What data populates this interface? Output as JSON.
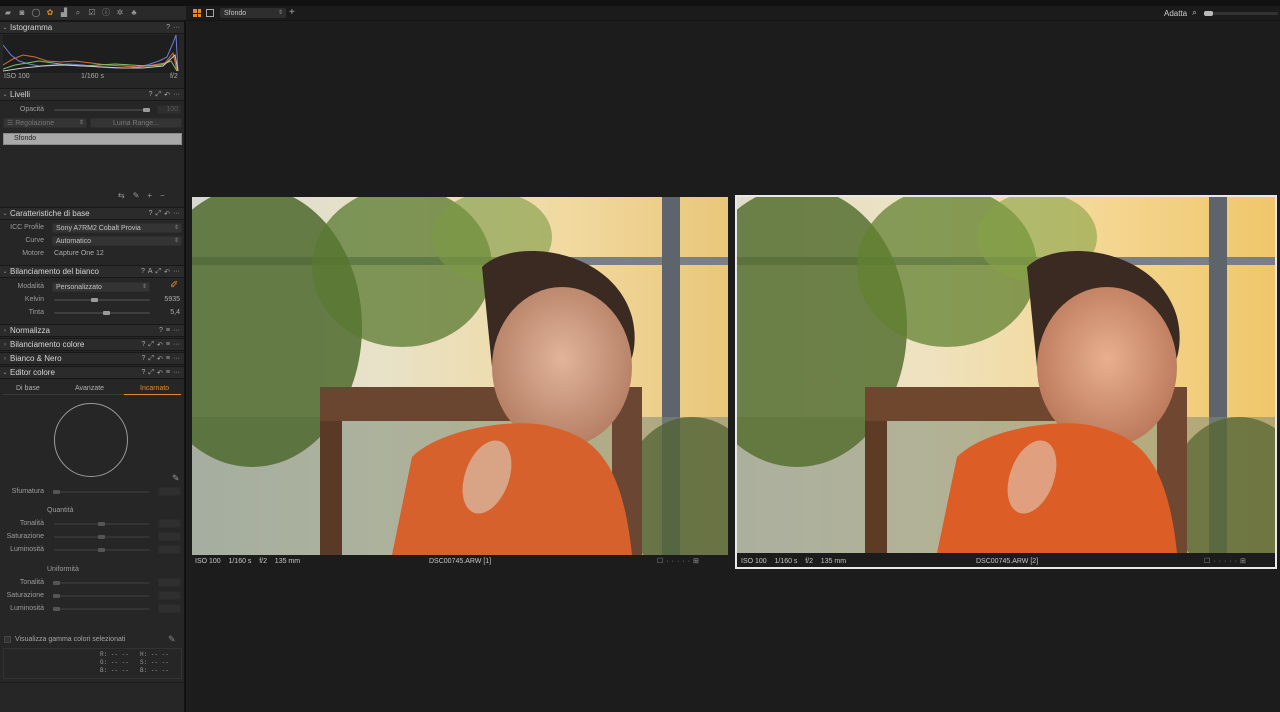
{
  "toolbar": {
    "icons": [
      "folder-icon",
      "camera-icon",
      "lens-icon",
      "color-wheel-icon",
      "exposure-icon",
      "search-icon",
      "checklist-icon",
      "info-icon",
      "gear-icon",
      "people-icon"
    ]
  },
  "viewer_bar": {
    "layer_select": "Sfondo",
    "fit_label": "Adatta"
  },
  "histogram": {
    "title": "Istogramma",
    "iso": "ISO 100",
    "shutter": "1/160 s",
    "aperture": "f/2"
  },
  "layers": {
    "title": "Livelli",
    "opacity_label": "Opacità",
    "opacity_value": "100",
    "adjust_label": "Regolazione",
    "luma_label": "Luma Range...",
    "layer_name": "Sfondo"
  },
  "basic": {
    "title": "Caratteristiche di base",
    "icc_label": "ICC Profile",
    "icc_value": "Sony A7RM2 Cobalt Provia",
    "curve_label": "Curve",
    "curve_value": "Automatico",
    "engine_label": "Motore",
    "engine_value": "Capture One 12"
  },
  "wb": {
    "title": "Bilanciamento del bianco",
    "mode_label": "Modalità",
    "mode_value": "Personalizzato",
    "kelvin_label": "Kelvin",
    "kelvin_value": "5935",
    "kelvin_pos": 0.42,
    "tint_label": "Tinta",
    "tint_value": "5,4",
    "tint_pos": 0.55
  },
  "sections": {
    "normalize": "Normalizza",
    "color_balance": "Bilanciamento colore",
    "bw": "Bianco & Nero",
    "color_editor": "Editor colore"
  },
  "color_editor": {
    "tab_basic": "Di base",
    "tab_advanced": "Avanzate",
    "tab_skin": "Incarnato",
    "smooth_label": "Sfumatura",
    "amount_title": "Quantità",
    "uniform_title": "Uniformità",
    "hue_label": "Tonalità",
    "sat_label": "Saturazione",
    "lum_label": "Luminosità",
    "show_gamut": "Visualizza gamma colori selezionati",
    "r": "R:",
    "g": "G:",
    "b": "B:",
    "h": "H:",
    "s": "S:",
    "b2": "B:",
    "dash": "--"
  },
  "images": [
    {
      "iso": "ISO 100",
      "shutter": "1/160 s",
      "aperture": "f/2",
      "focal": "135 mm",
      "file": "DSC00745.ARW [1]"
    },
    {
      "iso": "ISO 100",
      "shutter": "1/160 s",
      "aperture": "f/2",
      "focal": "135 mm",
      "file": "DSC00745.ARW [2]"
    }
  ],
  "colors": {
    "accent": "#e08a2a",
    "panel": "#262626",
    "viewer": "#1c1c1c"
  }
}
